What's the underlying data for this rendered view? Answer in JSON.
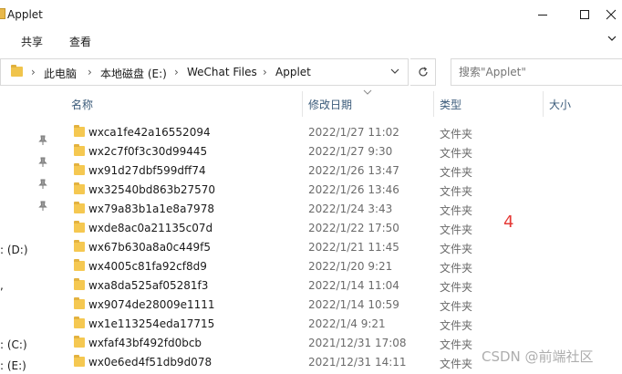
{
  "window": {
    "title": "Applet"
  },
  "ribbon": {
    "tabs": [
      "共享",
      "查看"
    ]
  },
  "address": {
    "crumbs": [
      "此电脑",
      "本地磁盘 (E:)",
      "WeChat Files",
      "Applet"
    ],
    "separators": [
      "›",
      "›",
      "›",
      "›"
    ]
  },
  "search": {
    "placeholder": "搜索\"Applet\""
  },
  "columns": {
    "name": "名称",
    "modified": "修改日期",
    "type": "类型",
    "size": "大小"
  },
  "nav": {
    "drive_d": ": (D:)",
    "drive_c": ": (C:)",
    "drive_e": ": (E:)",
    "mark": ","
  },
  "files": [
    {
      "name": "wxca1fe42a16552094",
      "date": "2022/1/27 11:02",
      "type": "文件夹"
    },
    {
      "name": "wx2c7f0f3c30d99445",
      "date": "2022/1/27 9:30",
      "type": "文件夹"
    },
    {
      "name": "wx91d27dbf599dff74",
      "date": "2022/1/26 13:47",
      "type": "文件夹"
    },
    {
      "name": "wx32540bd863b27570",
      "date": "2022/1/26 13:46",
      "type": "文件夹"
    },
    {
      "name": "wx79a83b1a1e8a7978",
      "date": "2022/1/24 3:43",
      "type": "文件夹"
    },
    {
      "name": "wxde8ac0a21135c07d",
      "date": "2022/1/22 17:50",
      "type": "文件夹"
    },
    {
      "name": "wx67b630a8a0c449f5",
      "date": "2022/1/21 11:45",
      "type": "文件夹"
    },
    {
      "name": "wx4005c81fa92cf8d9",
      "date": "2022/1/20 9:21",
      "type": "文件夹"
    },
    {
      "name": "wxa8da525af05281f3",
      "date": "2022/1/14 11:04",
      "type": "文件夹"
    },
    {
      "name": "wx9074de28009e1111",
      "date": "2022/1/14 10:59",
      "type": "文件夹"
    },
    {
      "name": "wx1e113254eda17715",
      "date": "2022/1/4 9:21",
      "type": "文件夹"
    },
    {
      "name": "wxfaf43bf492fd0bcb",
      "date": "2021/12/31 17:08",
      "type": "文件夹"
    },
    {
      "name": "wx0e6ed4f51db9d078",
      "date": "2021/12/31 14:11",
      "type": "文件夹"
    }
  ],
  "annotation": "4",
  "watermark": "CSDN @前端社区",
  "colors": {
    "folder": "#f5c851",
    "accent": "#e53935",
    "header_text": "#3b5b7a"
  }
}
